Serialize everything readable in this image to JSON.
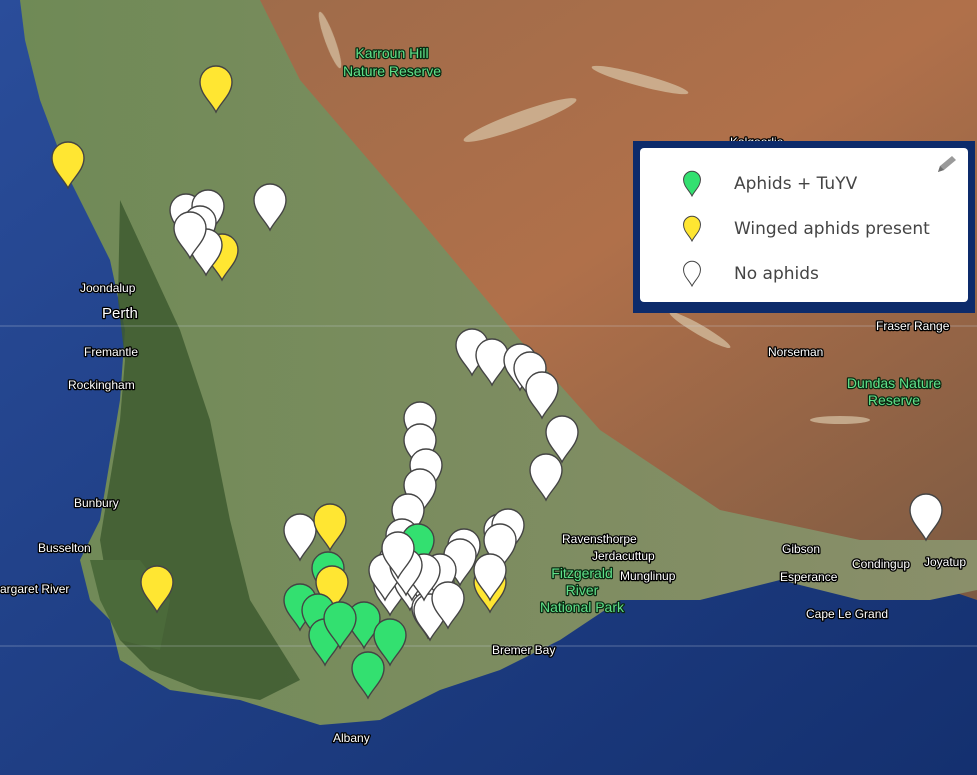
{
  "map": {
    "places": [
      {
        "id": "perth",
        "label": "Perth",
        "big": true
      },
      {
        "id": "joondalup",
        "label": "Joondalup"
      },
      {
        "id": "fremantle",
        "label": "Fremantle"
      },
      {
        "id": "rockingham",
        "label": "Rockingham"
      },
      {
        "id": "bunbury",
        "label": "Bunbury"
      },
      {
        "id": "busselton",
        "label": "Busselton"
      },
      {
        "id": "margaret",
        "label": "argaret River"
      },
      {
        "id": "albany",
        "label": "Albany"
      },
      {
        "id": "bremer",
        "label": "Bremer Bay"
      },
      {
        "id": "ravensthorpe",
        "label": "Ravensthorpe"
      },
      {
        "id": "jerdacuttup",
        "label": "Jerdacuttup"
      },
      {
        "id": "munglinup",
        "label": "Munglinup"
      },
      {
        "id": "gibson",
        "label": "Gibson"
      },
      {
        "id": "esperance",
        "label": "Esperance"
      },
      {
        "id": "condingup",
        "label": "Condingup"
      },
      {
        "id": "joyatup",
        "label": "Joyatup"
      },
      {
        "id": "capelegrand",
        "label": "Cape Le Grand"
      },
      {
        "id": "norseman",
        "label": "Norseman"
      },
      {
        "id": "fraser",
        "label": "Fraser Range"
      },
      {
        "id": "kalgoorlie",
        "label": "Kalgoorlie"
      }
    ],
    "parks": [
      {
        "id": "karroun",
        "lines": [
          "Karroun Hill",
          "Nature Reserve"
        ]
      },
      {
        "id": "dundas",
        "lines": [
          "Dundas Nature",
          "Reserve"
        ]
      },
      {
        "id": "fitzgerald",
        "lines": [
          "Fitzgerald",
          "River",
          "National Park"
        ]
      }
    ],
    "markers": [
      {
        "status": "yellow"
      },
      {
        "status": "yellow"
      },
      {
        "status": "white"
      },
      {
        "status": "white"
      },
      {
        "status": "yellow"
      },
      {
        "status": "white"
      },
      {
        "status": "white"
      },
      {
        "status": "white"
      },
      {
        "status": "white"
      },
      {
        "status": "white"
      },
      {
        "status": "white"
      },
      {
        "status": "white"
      },
      {
        "status": "white"
      },
      {
        "status": "white"
      },
      {
        "status": "white"
      },
      {
        "status": "white"
      },
      {
        "status": "white"
      },
      {
        "status": "white"
      },
      {
        "status": "white"
      },
      {
        "status": "white"
      },
      {
        "status": "white"
      },
      {
        "status": "white"
      },
      {
        "status": "white"
      },
      {
        "status": "white"
      },
      {
        "status": "white"
      },
      {
        "status": "white"
      },
      {
        "status": "white"
      },
      {
        "status": "white"
      },
      {
        "status": "green"
      },
      {
        "status": "white"
      },
      {
        "status": "white"
      },
      {
        "status": "white"
      },
      {
        "status": "yellow"
      },
      {
        "status": "white"
      },
      {
        "status": "yellow"
      },
      {
        "status": "green"
      },
      {
        "status": "green"
      },
      {
        "status": "yellow"
      },
      {
        "status": "green"
      },
      {
        "status": "green"
      },
      {
        "status": "green"
      },
      {
        "status": "green"
      },
      {
        "status": "green"
      },
      {
        "status": "green"
      },
      {
        "status": "yellow"
      },
      {
        "status": "white"
      },
      {
        "status": "white"
      },
      {
        "status": "white"
      },
      {
        "status": "white"
      },
      {
        "status": "white"
      },
      {
        "status": "white"
      },
      {
        "status": "white"
      },
      {
        "status": "white"
      },
      {
        "status": "white"
      },
      {
        "status": "white"
      },
      {
        "status": "white"
      },
      {
        "status": "white"
      },
      {
        "status": "white"
      }
    ]
  },
  "legend": {
    "items": [
      {
        "label": "Aphids + TuYV",
        "status": "green"
      },
      {
        "label": "Winged aphids present",
        "status": "yellow"
      },
      {
        "label": "No aphids",
        "status": "white"
      }
    ]
  },
  "colors": {
    "green": "#33e070",
    "yellow": "#ffe632",
    "white": "#ffffff",
    "ocean": "#1d3d8a",
    "legend_border": "#0d2b6b"
  },
  "icons": {
    "marker": "map-pin-icon",
    "edit": "pencil-icon"
  }
}
